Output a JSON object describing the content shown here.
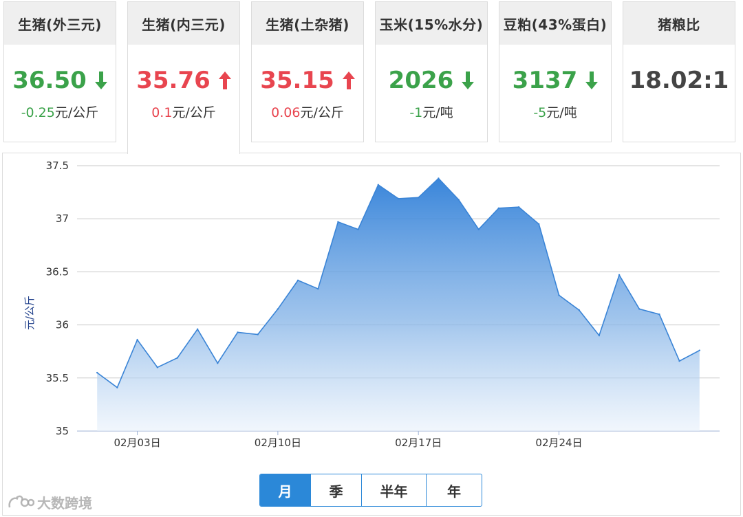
{
  "tabs": [
    {
      "title": "生猪(外三元)",
      "price": "36.50",
      "direction": "down",
      "change_value": "-0.25",
      "change_unit": "元/公斤"
    },
    {
      "title": "生猪(内三元)",
      "price": "35.76",
      "direction": "up",
      "change_value": "0.1",
      "change_unit": "元/公斤"
    },
    {
      "title": "生猪(土杂猪)",
      "price": "35.15",
      "direction": "up",
      "change_value": "0.06",
      "change_unit": "元/公斤"
    },
    {
      "title": "玉米(15%水分)",
      "price": "2026",
      "direction": "down",
      "change_value": "-1",
      "change_unit": "元/吨"
    },
    {
      "title": "豆粕(43%蛋白)",
      "price": "3137",
      "direction": "down",
      "change_value": "-5",
      "change_unit": "元/吨"
    },
    {
      "title": "猪粮比",
      "price": "18.02:1",
      "direction": "none",
      "change_value": "",
      "change_unit": ""
    }
  ],
  "active_tab": 1,
  "colors": {
    "up": "#e8454f",
    "down": "#3ba24a",
    "accent": "#2b88d8",
    "line": "#3a84d6"
  },
  "chart_data": {
    "type": "area",
    "ylabel": "元/公斤",
    "ylim": [
      35,
      37.5
    ],
    "yticks": [
      "35",
      "35.5",
      "36",
      "36.5",
      "37",
      "37.5"
    ],
    "xtick_labels": [
      "02月03日",
      "02月10日",
      "02月17日",
      "02月24日"
    ],
    "xtick_days": [
      3,
      10,
      17,
      24
    ],
    "x_days": [
      1,
      2,
      3,
      4,
      5,
      6,
      7,
      8,
      9,
      10,
      11,
      12,
      13,
      14,
      15,
      16,
      17,
      18,
      19,
      20,
      21,
      22,
      23,
      24,
      25,
      26,
      27,
      28,
      29,
      30,
      31
    ],
    "values": [
      35.55,
      35.41,
      35.86,
      35.6,
      35.69,
      35.96,
      35.64,
      35.93,
      35.91,
      36.15,
      36.42,
      36.34,
      36.97,
      36.9,
      37.32,
      37.19,
      37.2,
      37.38,
      37.18,
      36.9,
      37.1,
      37.11,
      36.95,
      36.28,
      36.14,
      35.9,
      36.47,
      36.15,
      36.1,
      35.66,
      35.76
    ]
  },
  "range_buttons": [
    "月",
    "季",
    "半年",
    "年"
  ],
  "active_range": 0,
  "watermark": "大数跨境"
}
